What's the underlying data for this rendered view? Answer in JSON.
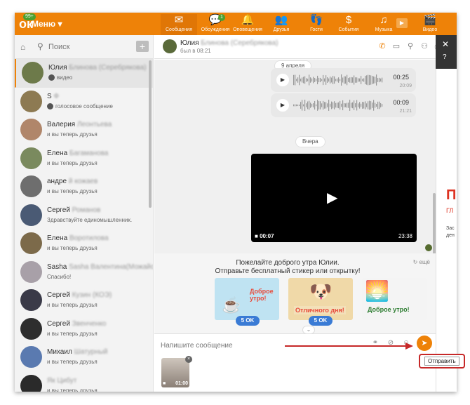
{
  "top_nav": {
    "logo_badge": "99+",
    "menu_label": "Меню",
    "items": [
      {
        "label": "Сообщения",
        "icon": "envelope-icon",
        "active": true
      },
      {
        "label": "Обсуждения",
        "icon": "chat-bubbles-icon",
        "badge": "1"
      },
      {
        "label": "Оповещения",
        "icon": "bell-icon"
      },
      {
        "label": "Друзья",
        "icon": "friends-icon"
      },
      {
        "label": "Гости",
        "icon": "footprints-icon"
      },
      {
        "label": "События",
        "icon": "events-icon"
      },
      {
        "label": "Музыка",
        "icon": "music-note-icon"
      },
      {
        "label": "Видео",
        "icon": "video-icon"
      }
    ]
  },
  "sidebar": {
    "search_placeholder": "Поиск",
    "chats": [
      {
        "name": "Юлия",
        "name_blur": "Блинова (Серебрякова)",
        "subtitle": "видео",
        "active": true,
        "avatar_color": "#6d7a4a"
      },
      {
        "name": "S",
        "name_blur": "Ф",
        "subtitle": "голосовое сообщение",
        "avatar_color": "#8d7a52"
      },
      {
        "name": "Валерия",
        "name_blur": "Леонтьева",
        "subtitle": "и вы теперь друзья",
        "avatar_color": "#b0866a"
      },
      {
        "name": "Елена",
        "name_blur": "Багаманова",
        "subtitle": "и вы теперь друзья",
        "avatar_color": "#7a8a5e"
      },
      {
        "name": "андре",
        "name_blur": "й кожаев",
        "subtitle": "и вы теперь друзья",
        "avatar_color": "#6e6e6e"
      },
      {
        "name": "Сергей",
        "name_blur": "Романов",
        "subtitle": "Здравствуйте единомышленник.",
        "avatar_color": "#4a5a74"
      },
      {
        "name": "Елена",
        "name_blur": "Воротилова",
        "subtitle": "и вы теперь друзья",
        "avatar_color": "#7c6a4a"
      },
      {
        "name": "Sasha",
        "name_blur": "Sasha Валентина(Можайськая)",
        "subtitle": "Спасибо!",
        "avatar_color": "#a8a0a8"
      },
      {
        "name": "Сергей",
        "name_blur": "Кузин (КОЭ)",
        "subtitle": "и вы теперь друзья",
        "avatar_color": "#3a3a48"
      },
      {
        "name": "Сергей",
        "name_blur": "Звенченко",
        "subtitle": "и вы теперь друзья",
        "avatar_color": "#2e2e2e"
      },
      {
        "name": "Михаил",
        "name_blur": "Шатурный",
        "subtitle": "и вы теперь друзья",
        "avatar_color": "#5a7ab0"
      },
      {
        "name": "",
        "name_blur": "Як Цибут",
        "subtitle": "и вы теперь друзья",
        "avatar_color": "#2a2a2a"
      }
    ]
  },
  "chat_header": {
    "name": "Юлия",
    "name_blur": "Блинова (Серебрякова)",
    "status": "был в 08:21"
  },
  "messages": {
    "date_1": "9 апреля",
    "voice_1": {
      "duration": "00:25",
      "time": "20:09"
    },
    "voice_2": {
      "duration": "00:09",
      "time": "21:21"
    },
    "date_2": "Вчера",
    "video": {
      "duration": "00:07",
      "time": "23:38"
    }
  },
  "promo": {
    "line_1": "Пожелайте доброго утра Юлии.",
    "line_2": "Отправьте бесплатный стикер или открытку!",
    "more": "ещё",
    "stickers": [
      {
        "text": "Доброе утро!",
        "price": "5 OK",
        "color": "#bfe3f2"
      },
      {
        "text": "Отличного дня!",
        "price": "5 OK",
        "color": "#f0d9a8"
      },
      {
        "text": "Доброе утро!",
        "price": "",
        "color": "#f4f4f4"
      }
    ]
  },
  "compose": {
    "placeholder": "Напишите сообщение",
    "attachment_duration": "01:00",
    "send_tooltip": "Отправить"
  },
  "right_panel": {
    "red_letter": "П",
    "line_1": "ГЛ",
    "line_2": "Зас",
    "line_3": "ден"
  },
  "colors": {
    "brand": "#ee8208",
    "highlight": "#c62828",
    "price_badge": "#3a7bd5"
  }
}
